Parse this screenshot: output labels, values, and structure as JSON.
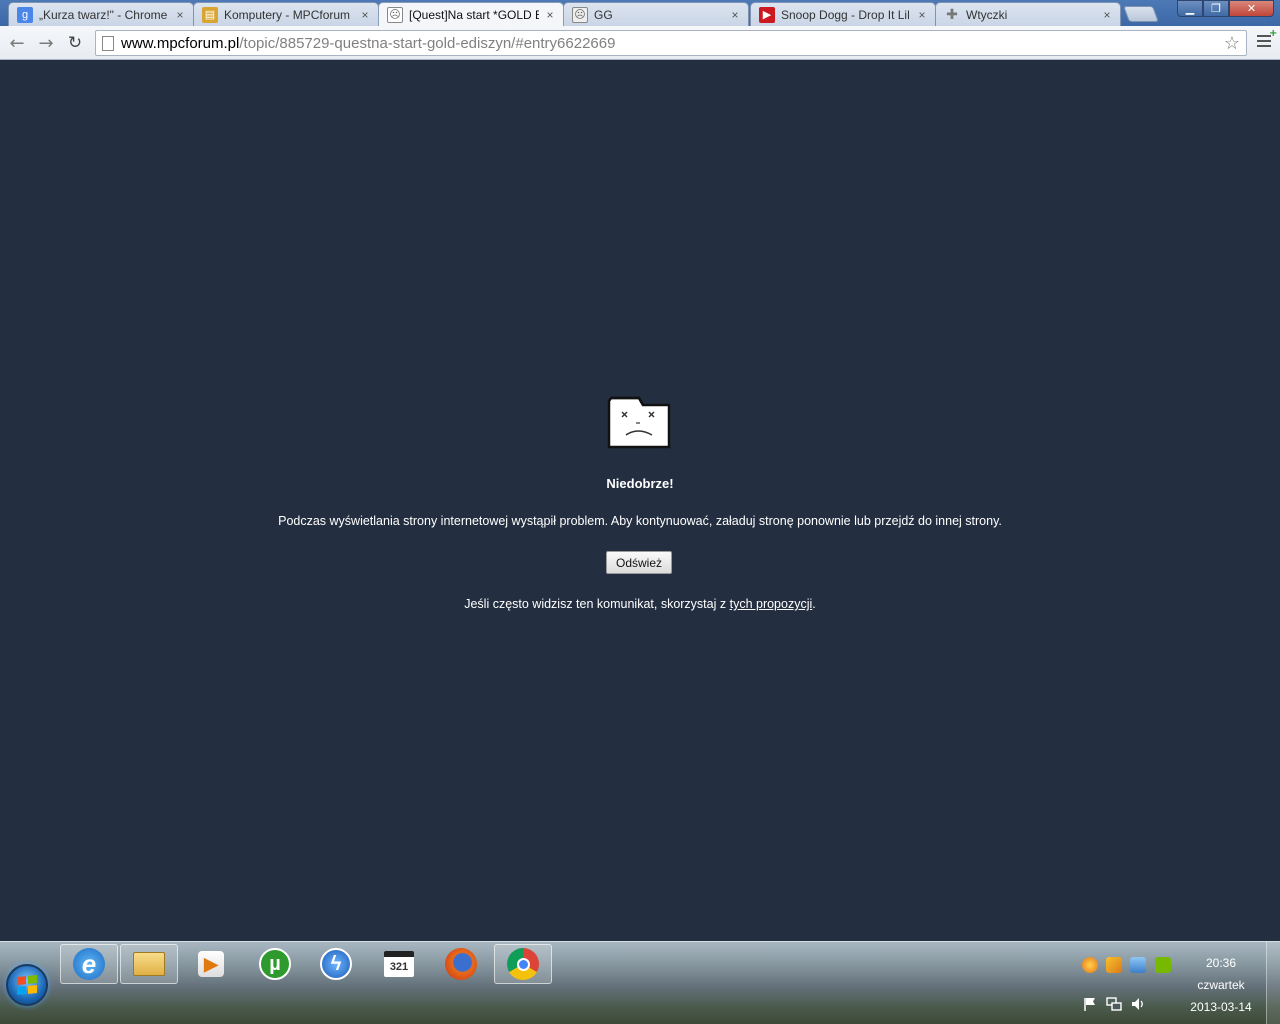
{
  "window": {
    "minimize_glyph": "▁",
    "maximize_glyph": "❐",
    "close_glyph": "✕"
  },
  "tabs": [
    {
      "title": "„Kurza twarz!\" - Chrome",
      "icon": "google-icon",
      "color": "#4a86e8",
      "active": false
    },
    {
      "title": "Komputery - MPCforum",
      "icon": "mpcforum-icon",
      "color": "#d9a430",
      "active": false
    },
    {
      "title": "[Quest]Na start *GOLD E",
      "icon": "sad-page-icon",
      "color": "#8a8a8a",
      "active": true
    },
    {
      "title": "GG",
      "icon": "sad-page-icon",
      "color": "#8a8a8a",
      "active": false
    },
    {
      "title": "Snoop Dogg - Drop It Lil",
      "icon": "youtube-icon",
      "color": "#cc181e",
      "active": false
    },
    {
      "title": "Wtyczki",
      "icon": "puzzle-icon",
      "color": "#777777",
      "active": false
    }
  ],
  "tab_close_glyph": "×",
  "toolbar": {
    "back_glyph": "←",
    "forward_glyph": "→",
    "reload_glyph": "↻",
    "url_host": "www.mpcforum.pl",
    "url_path": "/topic/885729-questna-start-gold-ediszyn/#entry6622669",
    "star_glyph": "☆"
  },
  "sad_tab": {
    "title": "Niedobrze!",
    "message": "Podczas wyświetlania strony internetowej wystąpił problem. Aby kontynuować, załaduj stronę ponownie lub przejdź do innej strony.",
    "reload_label": "Odśwież",
    "help_prefix": "Jeśli często widzisz ten komunikat, skorzystaj z ",
    "help_link": "tych propozycji",
    "help_suffix": "."
  },
  "taskbar": {
    "pinned": [
      {
        "name": "internet-explorer",
        "glyph": "e"
      },
      {
        "name": "windows-explorer",
        "glyph": ""
      },
      {
        "name": "media-player",
        "glyph": "▶"
      },
      {
        "name": "utorrent",
        "glyph": "µ"
      },
      {
        "name": "daemon-tools",
        "glyph": "ϟ"
      },
      {
        "name": "media-player-classic",
        "glyph": "321"
      },
      {
        "name": "firefox",
        "glyph": ""
      },
      {
        "name": "chrome",
        "glyph": ""
      }
    ],
    "clock": {
      "time": "20:36",
      "day": "czwartek",
      "date": "2013-03-14"
    }
  }
}
